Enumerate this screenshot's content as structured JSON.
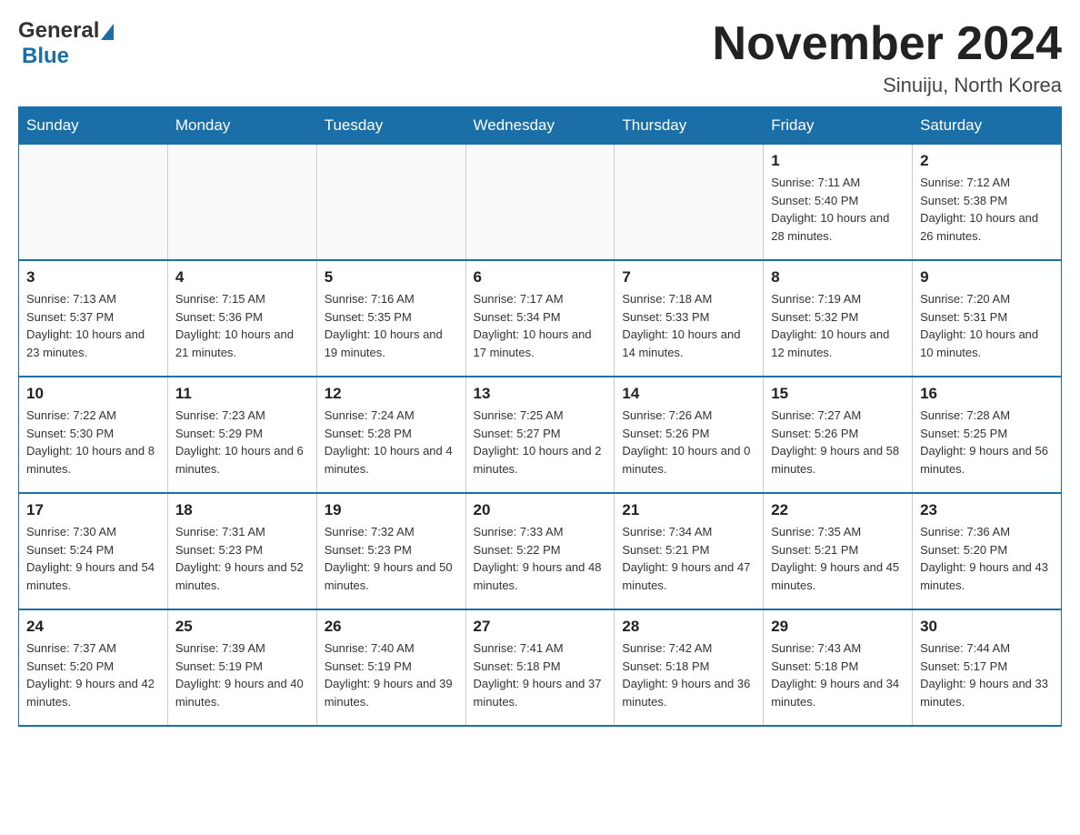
{
  "header": {
    "logo_general": "General",
    "logo_blue": "Blue",
    "title": "November 2024",
    "location": "Sinuiju, North Korea"
  },
  "weekdays": [
    "Sunday",
    "Monday",
    "Tuesday",
    "Wednesday",
    "Thursday",
    "Friday",
    "Saturday"
  ],
  "weeks": [
    [
      {
        "day": "",
        "info": ""
      },
      {
        "day": "",
        "info": ""
      },
      {
        "day": "",
        "info": ""
      },
      {
        "day": "",
        "info": ""
      },
      {
        "day": "",
        "info": ""
      },
      {
        "day": "1",
        "info": "Sunrise: 7:11 AM\nSunset: 5:40 PM\nDaylight: 10 hours and 28 minutes."
      },
      {
        "day": "2",
        "info": "Sunrise: 7:12 AM\nSunset: 5:38 PM\nDaylight: 10 hours and 26 minutes."
      }
    ],
    [
      {
        "day": "3",
        "info": "Sunrise: 7:13 AM\nSunset: 5:37 PM\nDaylight: 10 hours and 23 minutes."
      },
      {
        "day": "4",
        "info": "Sunrise: 7:15 AM\nSunset: 5:36 PM\nDaylight: 10 hours and 21 minutes."
      },
      {
        "day": "5",
        "info": "Sunrise: 7:16 AM\nSunset: 5:35 PM\nDaylight: 10 hours and 19 minutes."
      },
      {
        "day": "6",
        "info": "Sunrise: 7:17 AM\nSunset: 5:34 PM\nDaylight: 10 hours and 17 minutes."
      },
      {
        "day": "7",
        "info": "Sunrise: 7:18 AM\nSunset: 5:33 PM\nDaylight: 10 hours and 14 minutes."
      },
      {
        "day": "8",
        "info": "Sunrise: 7:19 AM\nSunset: 5:32 PM\nDaylight: 10 hours and 12 minutes."
      },
      {
        "day": "9",
        "info": "Sunrise: 7:20 AM\nSunset: 5:31 PM\nDaylight: 10 hours and 10 minutes."
      }
    ],
    [
      {
        "day": "10",
        "info": "Sunrise: 7:22 AM\nSunset: 5:30 PM\nDaylight: 10 hours and 8 minutes."
      },
      {
        "day": "11",
        "info": "Sunrise: 7:23 AM\nSunset: 5:29 PM\nDaylight: 10 hours and 6 minutes."
      },
      {
        "day": "12",
        "info": "Sunrise: 7:24 AM\nSunset: 5:28 PM\nDaylight: 10 hours and 4 minutes."
      },
      {
        "day": "13",
        "info": "Sunrise: 7:25 AM\nSunset: 5:27 PM\nDaylight: 10 hours and 2 minutes."
      },
      {
        "day": "14",
        "info": "Sunrise: 7:26 AM\nSunset: 5:26 PM\nDaylight: 10 hours and 0 minutes."
      },
      {
        "day": "15",
        "info": "Sunrise: 7:27 AM\nSunset: 5:26 PM\nDaylight: 9 hours and 58 minutes."
      },
      {
        "day": "16",
        "info": "Sunrise: 7:28 AM\nSunset: 5:25 PM\nDaylight: 9 hours and 56 minutes."
      }
    ],
    [
      {
        "day": "17",
        "info": "Sunrise: 7:30 AM\nSunset: 5:24 PM\nDaylight: 9 hours and 54 minutes."
      },
      {
        "day": "18",
        "info": "Sunrise: 7:31 AM\nSunset: 5:23 PM\nDaylight: 9 hours and 52 minutes."
      },
      {
        "day": "19",
        "info": "Sunrise: 7:32 AM\nSunset: 5:23 PM\nDaylight: 9 hours and 50 minutes."
      },
      {
        "day": "20",
        "info": "Sunrise: 7:33 AM\nSunset: 5:22 PM\nDaylight: 9 hours and 48 minutes."
      },
      {
        "day": "21",
        "info": "Sunrise: 7:34 AM\nSunset: 5:21 PM\nDaylight: 9 hours and 47 minutes."
      },
      {
        "day": "22",
        "info": "Sunrise: 7:35 AM\nSunset: 5:21 PM\nDaylight: 9 hours and 45 minutes."
      },
      {
        "day": "23",
        "info": "Sunrise: 7:36 AM\nSunset: 5:20 PM\nDaylight: 9 hours and 43 minutes."
      }
    ],
    [
      {
        "day": "24",
        "info": "Sunrise: 7:37 AM\nSunset: 5:20 PM\nDaylight: 9 hours and 42 minutes."
      },
      {
        "day": "25",
        "info": "Sunrise: 7:39 AM\nSunset: 5:19 PM\nDaylight: 9 hours and 40 minutes."
      },
      {
        "day": "26",
        "info": "Sunrise: 7:40 AM\nSunset: 5:19 PM\nDaylight: 9 hours and 39 minutes."
      },
      {
        "day": "27",
        "info": "Sunrise: 7:41 AM\nSunset: 5:18 PM\nDaylight: 9 hours and 37 minutes."
      },
      {
        "day": "28",
        "info": "Sunrise: 7:42 AM\nSunset: 5:18 PM\nDaylight: 9 hours and 36 minutes."
      },
      {
        "day": "29",
        "info": "Sunrise: 7:43 AM\nSunset: 5:18 PM\nDaylight: 9 hours and 34 minutes."
      },
      {
        "day": "30",
        "info": "Sunrise: 7:44 AM\nSunset: 5:17 PM\nDaylight: 9 hours and 33 minutes."
      }
    ]
  ]
}
